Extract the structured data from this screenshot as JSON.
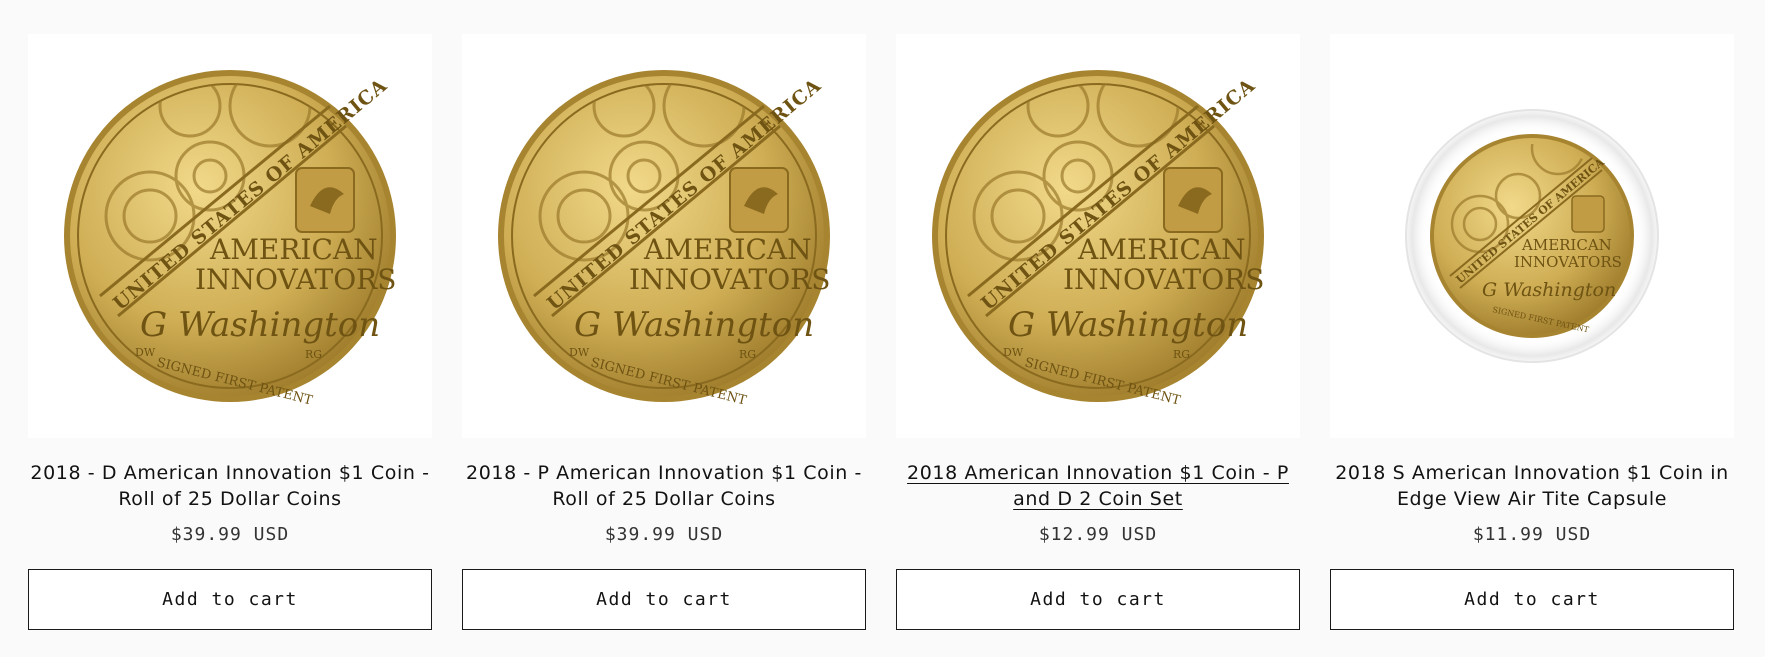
{
  "products": [
    {
      "title": "2018 - D American Innovation $1 Coin - Roll of 25 Dollar Coins",
      "price": "$39.99 USD",
      "button": "Add to cart",
      "image": "american-innovation-coin-image"
    },
    {
      "title": "2018 - P American Innovation $1 Coin - Roll of 25 Dollar Coins",
      "price": "$39.99 USD",
      "button": "Add to cart",
      "image": "american-innovation-coin-image"
    },
    {
      "title": "2018 American Innovation $1 Coin - P and D 2 Coin Set",
      "price": "$12.99 USD",
      "button": "Add to cart",
      "image": "american-innovation-coin-image"
    },
    {
      "title": "2018 S American Innovation $1 Coin in Edge View Air Tite Capsule",
      "price": "$11.99 USD",
      "button": "Add to cart",
      "image": "coin-in-capsule-image"
    }
  ],
  "coin": {
    "top_text": "UNITED STATES OF AMERICA",
    "line1": "AMERICAN",
    "line2": "INNOVATORS",
    "signature": "G Washington",
    "bottom_text": "SIGNED FIRST PATENT",
    "left_initials": "DW",
    "right_initials": "RG"
  },
  "colors": {
    "coin_gold": "#c9a646",
    "coin_dark": "#8a6a1f",
    "background": "#fafafa"
  }
}
